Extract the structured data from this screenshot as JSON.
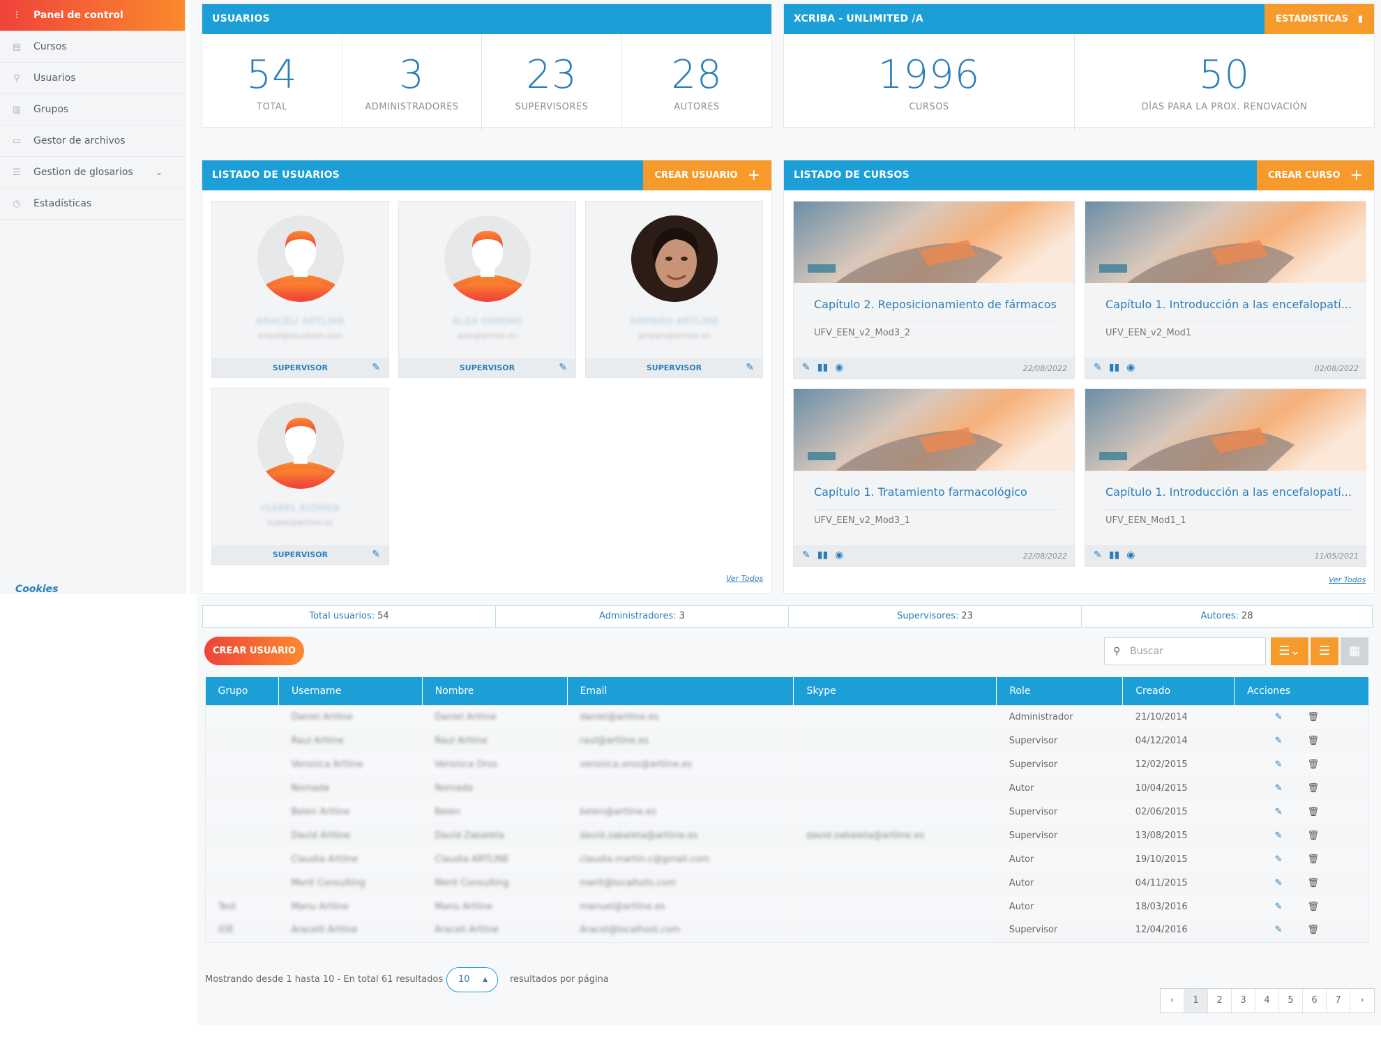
{
  "sidebar": {
    "items": [
      {
        "label": "Panel de control",
        "icon": "sliders-icon",
        "active": true
      },
      {
        "label": "Cursos",
        "icon": "book-icon"
      },
      {
        "label": "Usuarios",
        "icon": "user-icon"
      },
      {
        "label": "Grupos",
        "icon": "building-icon"
      },
      {
        "label": "Gestor de archivos",
        "icon": "folder-icon"
      },
      {
        "label": "Gestion de glosarios",
        "icon": "list-icon"
      },
      {
        "label": "Estadísticas",
        "icon": "clock-icon"
      }
    ],
    "cookies": "Cookies"
  },
  "usuarios_panel": {
    "title": "USUARIOS",
    "stats": [
      {
        "value": "54",
        "label": "TOTAL"
      },
      {
        "value": "3",
        "label": "ADMINISTRADORES"
      },
      {
        "value": "23",
        "label": "SUPERVISORES"
      },
      {
        "value": "28",
        "label": "AUTORES"
      }
    ]
  },
  "xcriba_panel": {
    "title": "XCRIBA - UNLIMITED /A",
    "button": "ESTADISTICAS",
    "stats": [
      {
        "value": "1996",
        "label": "CURSOS"
      },
      {
        "value": "50",
        "label": "DÍAS PARA LA PROX. RENOVACIÓN"
      }
    ]
  },
  "listado_usuarios": {
    "title": "LISTADO DE USUARIOS",
    "button": "CREAR USUARIO",
    "cards": [
      {
        "name": "ARACELI ARTLINE",
        "email": "aracel@localhost.com",
        "role": "SUPERVISOR"
      },
      {
        "name": "ALEX GIMENO",
        "email": "alex@artline.es",
        "role": "SUPERVISOR"
      },
      {
        "name": "AMPARO ARTLINE",
        "email": "amparo@artline.es",
        "role": "SUPERVISOR"
      },
      {
        "name": "ISABEL RIONDA",
        "email": "isabel@artline.es",
        "role": "SUPERVISOR"
      }
    ],
    "ver_todos": "Ver Todos"
  },
  "listado_cursos": {
    "title": "LISTADO DE CURSOS",
    "button": "CREAR CURSO",
    "cards": [
      {
        "title": "Capítulo 2. Reposicionamiento de fármacos",
        "code": "UFV_EEN_v2_Mod3_2",
        "date": "22/08/2022"
      },
      {
        "title": "Capítulo 1. Introducción a las encefalopatí...",
        "code": "UFV_EEN_v2_Mod1",
        "date": "02/08/2022"
      },
      {
        "title": "Capítulo 1. Tratamiento farmacológico",
        "code": "UFV_EEN_v2_Mod3_1",
        "date": "22/08/2022"
      },
      {
        "title": "Capítulo 1. Introducción a las encefalopatí...",
        "code": "UFV_EEN_Mod1_1",
        "date": "11/05/2021"
      }
    ],
    "ver_todos": "Ver Todos"
  },
  "summary": {
    "total_label": "Total usuarios:",
    "total": "54",
    "admin_label": "Administradores:",
    "admin": "3",
    "sup_label": "Supervisores:",
    "sup": "23",
    "aut_label": "Autores:",
    "aut": "28"
  },
  "toolbar": {
    "crear_usuario": "CREAR USUARIO",
    "search_placeholder": "Buscar"
  },
  "table": {
    "headers": [
      "Grupo",
      "Username",
      "Nombre",
      "Email",
      "Skype",
      "Role",
      "Creado",
      "Acciones"
    ],
    "rows": [
      {
        "grupo": "",
        "username": "Daniel Artline",
        "nombre": "Daniel Artline",
        "email": "daniel@artline.es",
        "skype": "",
        "role": "Administrador",
        "creado": "21/10/2014"
      },
      {
        "grupo": "",
        "username": "Raul Artline",
        "nombre": "Raul Artline",
        "email": "raul@artline.es",
        "skype": "",
        "role": "Supervisor",
        "creado": "04/12/2014"
      },
      {
        "grupo": "",
        "username": "Veronica Artline",
        "nombre": "Veronica Oros",
        "email": "veronica.oros@artline.es",
        "skype": "",
        "role": "Supervisor",
        "creado": "12/02/2015"
      },
      {
        "grupo": "",
        "username": "Nomada",
        "nombre": "Nomada",
        "email": "",
        "skype": "",
        "role": "Autor",
        "creado": "10/04/2015"
      },
      {
        "grupo": "",
        "username": "Belen Artline",
        "nombre": "Belen",
        "email": "belen@artline.es",
        "skype": "",
        "role": "Supervisor",
        "creado": "02/06/2015"
      },
      {
        "grupo": "",
        "username": "David Artline",
        "nombre": "David Zabaleta",
        "email": "david.zabaleta@artline.es",
        "skype": "david.zabaleta@artline.es",
        "role": "Supervisor",
        "creado": "13/08/2015"
      },
      {
        "grupo": "",
        "username": "Claudia Artline",
        "nombre": "Claudia ARTLINE",
        "email": "claudia.martin.c@gmail.com",
        "skype": "",
        "role": "Autor",
        "creado": "19/10/2015"
      },
      {
        "grupo": "",
        "username": "Merit Consulting",
        "nombre": "Merit Consulting",
        "email": "merit@localhots.com",
        "skype": "",
        "role": "Autor",
        "creado": "04/11/2015"
      },
      {
        "grupo": "Test",
        "username": "Manu Artline",
        "nombre": "Manu Artline",
        "email": "manuel@artline.es",
        "skype": "",
        "role": "Autor",
        "creado": "18/03/2016"
      },
      {
        "grupo": "IOE",
        "username": "Aracelli Artline",
        "nombre": "Araceli Artline",
        "email": "Aracel@localhost.com",
        "skype": "",
        "role": "Supervisor",
        "creado": "12/04/2016"
      }
    ]
  },
  "pagination": {
    "info": "Mostrando desde 1 hasta 10 - En total 61 resultados",
    "per_page": "10",
    "per_page_label": "resultados por página",
    "prev": "‹",
    "pages": [
      "1",
      "2",
      "3",
      "4",
      "5",
      "6",
      "7"
    ],
    "next": "›",
    "current": "1"
  },
  "colors": {
    "primary": "#1b9fd6",
    "accent": "#f79a2c",
    "brand_gradient_start": "#f0433a",
    "brand_gradient_end": "#fb8a2d"
  }
}
